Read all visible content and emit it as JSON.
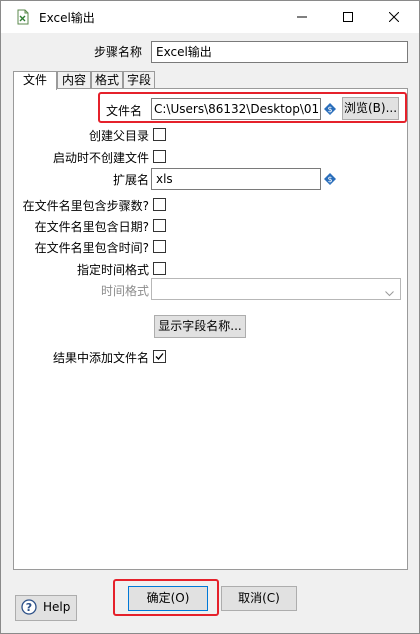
{
  "window": {
    "title": "Excel输出"
  },
  "step_name": {
    "label": "步骤名称",
    "value": "Excel输出"
  },
  "tabs": [
    {
      "label": "文件"
    },
    {
      "label": "内容"
    },
    {
      "label": "格式"
    },
    {
      "label": "字段"
    }
  ],
  "file": {
    "filename_label": "文件名",
    "filename_value": "C:\\Users\\86132\\Desktop\\01",
    "browse_label": "浏览(B)...",
    "create_parent_label": "创建父目录",
    "create_parent_checked": false,
    "no_create_on_start_label": "启动时不创建文件",
    "no_create_on_start_checked": false,
    "extension_label": "扩展名",
    "extension_value": "xls",
    "include_stepnr_label": "在文件名里包含步骤数?",
    "include_stepnr_checked": false,
    "include_date_label": "在文件名里包含日期?",
    "include_date_checked": false,
    "include_time_label": "在文件名里包含时间?",
    "include_time_checked": false,
    "specify_format_label": "指定时间格式",
    "specify_format_checked": false,
    "time_format_label": "时间格式",
    "time_format_value": "",
    "show_fields_label": "显示字段名称...",
    "add_to_result_label": "结果中添加文件名",
    "add_to_result_checked": true
  },
  "footer": {
    "help_label": "Help",
    "ok_label": "确定(O)",
    "cancel_label": "取消(C)"
  },
  "colors": {
    "highlight": "#e5212b",
    "variable_icon": "#2a6ebb"
  },
  "icons": {
    "app": "excel-output-step-icon",
    "variable": "variable-diamond-icon",
    "help": "question-circle-icon"
  }
}
